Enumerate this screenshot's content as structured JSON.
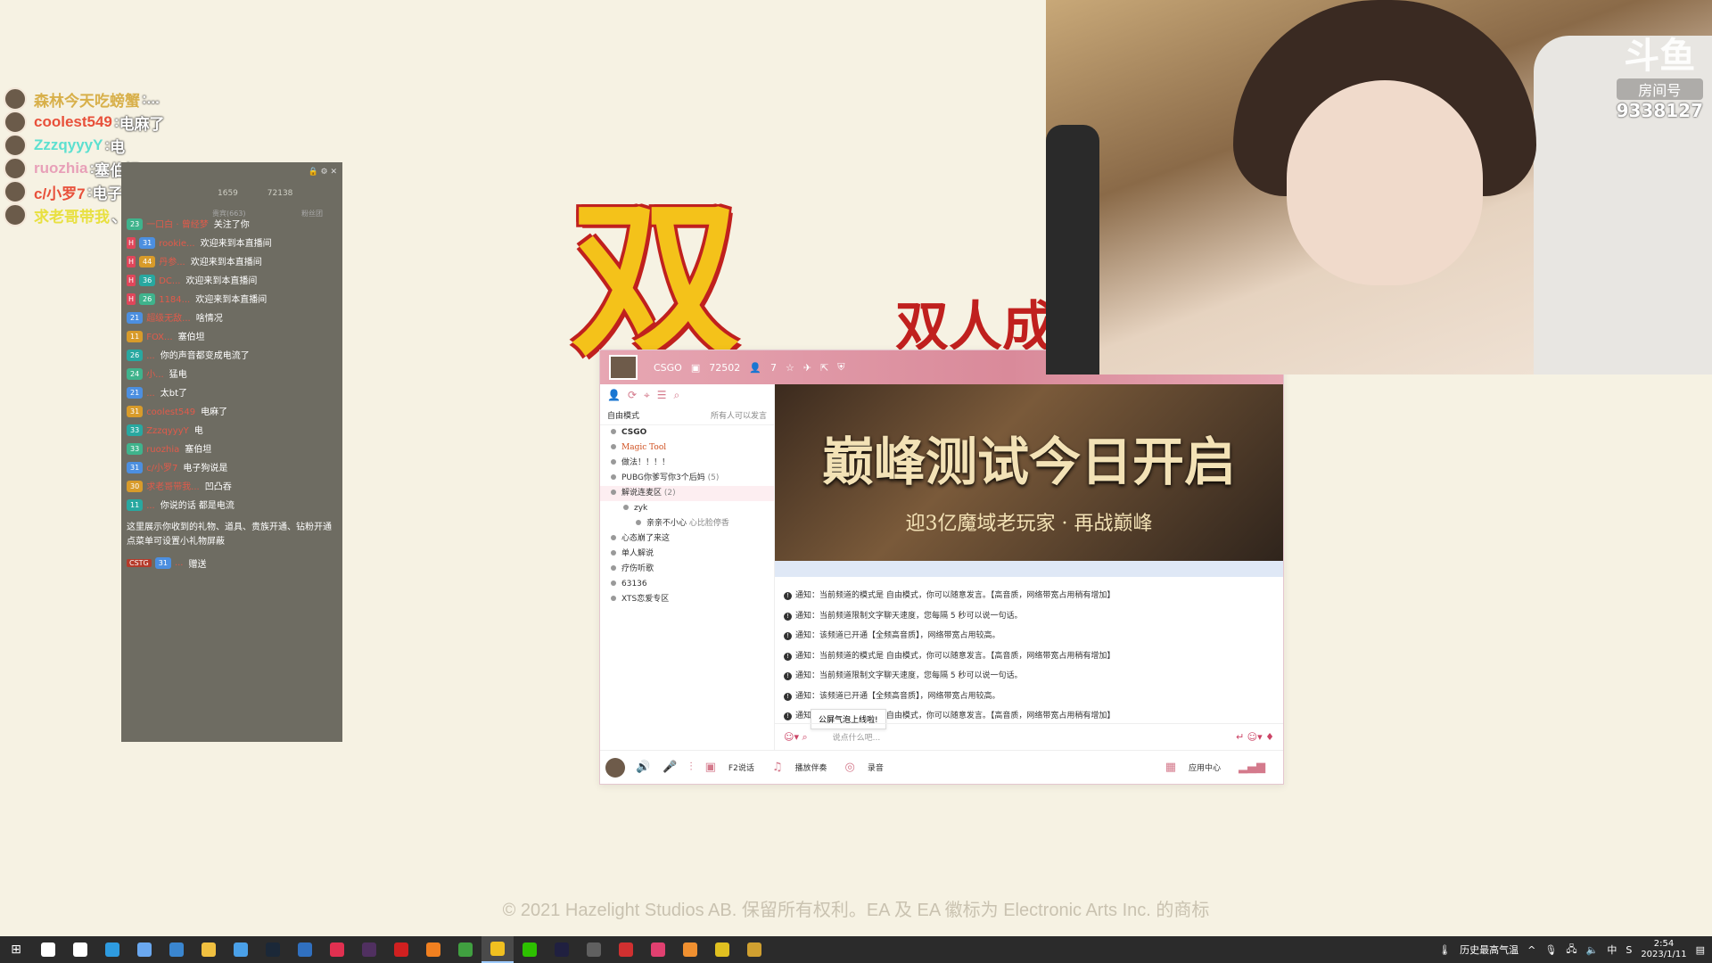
{
  "overlay_chat": [
    {
      "name": "森林今天吃螃蟹",
      "sep": ":",
      "msg": "...",
      "color": "#d8b04a"
    },
    {
      "name": "coolest549",
      "sep": ":",
      "msg": "电麻了",
      "color": "#e8503a"
    },
    {
      "name": "ZzzqyyyY",
      "sep": ":",
      "msg": "电",
      "color": "#5de0d0"
    },
    {
      "name": "ruozhia",
      "sep": ":",
      "msg": "塞伯坦",
      "color": "#e8a0b8"
    },
    {
      "name": "c/小罗7",
      "sep": ":",
      "msg": "电子狗说是",
      "color": "#e8503a"
    },
    {
      "name": "求老哥带我",
      "sep": "、",
      "msg": ":凹凸吞",
      "color": "#e8e040"
    }
  ],
  "chat_panel": {
    "stats": {
      "viewers": "1659",
      "likes": "72138"
    },
    "sub_left": "贵宾(663)",
    "sub_right": "粉丝团",
    "messages": [
      {
        "tag": "",
        "badge": "23",
        "user": "一口白 · 曾经梦",
        "text": "关注了你",
        "kind": "follow"
      },
      {
        "tag": "H",
        "badge": "31",
        "user": "rookie...",
        "text": "欢迎来到本直播间",
        "kind": "welcome"
      },
      {
        "tag": "H",
        "badge": "44",
        "user": "丹参...",
        "text": "欢迎来到本直播间",
        "kind": "welcome"
      },
      {
        "tag": "H",
        "badge": "36",
        "user": "DC...",
        "text": "欢迎来到本直播间",
        "kind": "welcome"
      },
      {
        "tag": "H",
        "badge": "26",
        "user": "1184...",
        "text": "欢迎来到本直播间",
        "kind": "welcome"
      },
      {
        "tag": "",
        "badge": "21",
        "user": "超级无敌...",
        "text": "啥情况",
        "kind": "chat"
      },
      {
        "tag": "",
        "badge": "11",
        "user": "FOX...",
        "text": "塞伯坦",
        "kind": "chat"
      },
      {
        "tag": "",
        "badge": "26",
        "user": "...",
        "text": "你的声音都变成电流了",
        "kind": "chat"
      },
      {
        "tag": "",
        "badge": "24",
        "user": "小...",
        "text": "猛电",
        "kind": "chat"
      },
      {
        "tag": "",
        "badge": "21",
        "user": "...",
        "text": "太bt了",
        "kind": "chat"
      },
      {
        "tag": "",
        "badge": "31",
        "user": "coolest549",
        "text": "电麻了",
        "kind": "chat"
      },
      {
        "tag": "",
        "badge": "33",
        "user": "ZzzqyyyY",
        "text": "电",
        "kind": "chat"
      },
      {
        "tag": "",
        "badge": "33",
        "user": "ruozhia",
        "text": "塞伯坦",
        "kind": "chat"
      },
      {
        "tag": "",
        "badge": "31",
        "user": "c/小罗7",
        "text": "电子狗说是",
        "kind": "chat"
      },
      {
        "tag": "",
        "badge": "30",
        "user": "求老哥带我...",
        "text": "凹凸吞",
        "kind": "chat"
      },
      {
        "tag": "",
        "badge": "11",
        "user": "...",
        "text": "你说的话 都是电流",
        "kind": "chat"
      }
    ],
    "tip_line1": "这里展示你收到的礼物、道具、贵族开通、钻粉开通",
    "tip_line2": "点菜单可设置小礼物屏蔽",
    "gift": {
      "tag": "CSTG",
      "badge": "31",
      "user": "...",
      "text": "赠送"
    }
  },
  "logo": {
    "big_char": "双",
    "chinese": "双人成"
  },
  "yy": {
    "title_game": "CSGO",
    "title_id": "72502",
    "title_users": "7",
    "mode_label": "自由模式",
    "mode_right": "所有人可以发言",
    "channels": [
      {
        "label": "CSGO",
        "style": "bold",
        "indent": 0
      },
      {
        "label": "Magic Tool",
        "style": "magic",
        "indent": 0
      },
      {
        "label": "做法！！！！",
        "style": "normal",
        "indent": 0
      },
      {
        "label": "PUBG你爹写你3个后妈",
        "style": "normal",
        "indent": 0,
        "count": "(5)"
      },
      {
        "label": "解说连麦区",
        "style": "active",
        "indent": 0,
        "count": "(2)"
      },
      {
        "label": "zyk",
        "style": "normal",
        "indent": 1
      },
      {
        "label": "亲亲不小心",
        "style": "normal",
        "indent": 2,
        "extra": "心比脸停香"
      },
      {
        "label": "心态崩了来这",
        "style": "normal",
        "indent": 0
      },
      {
        "label": "单人解说",
        "style": "normal",
        "indent": 0
      },
      {
        "label": "疗伤听歌",
        "style": "normal",
        "indent": 0
      },
      {
        "label": "63136",
        "style": "normal",
        "indent": 0
      },
      {
        "label": "XTS恋爱专区",
        "style": "normal",
        "indent": 0
      }
    ],
    "banner_title": "巅峰测试今日开启",
    "banner_sub": "迎3亿魔域老玩家 · 再战巅峰",
    "notices": [
      "通知：当前频道的模式是 自由模式，你可以随意发言。【高音质，网络带宽占用稍有增加】",
      "通知：当前频道限制文字聊天速度，您每隔 5 秒可以说一句话。",
      "通知：该频道已开通【全频高音质】，网络带宽占用较高。",
      "通知：当前频道的模式是 自由模式，你可以随意发言。【高音质，网络带宽占用稍有增加】",
      "通知：当前频道限制文字聊天速度，您每隔 5 秒可以说一句话。",
      "通知：该频道已开通【全频高音质】，网络带宽占用较高。",
      "通知：当前频道的模式是 自由模式，你可以随意发言。【高音质，网络带宽占用稍有增加】"
    ],
    "bubble": "公屏气泡上线啦!",
    "input_placeholder": "说点什么吧...",
    "bottom_f2": "F2说话",
    "bottom_music": "播放伴奏",
    "bottom_record": "录音",
    "bottom_app": "应用中心"
  },
  "webcam_watermark": {
    "title": "斗鱼",
    "sub": "房间号",
    "room": "9338127"
  },
  "copyright": "© 2021 Hazelight Studios AB. 保留所有权利。EA 及 EA 徽标为 Electronic Arts Inc. 的商标",
  "taskbar": {
    "weather": "历史最高气温",
    "ime": "中",
    "time": "2:54",
    "date": "2023/1/11",
    "apps": [
      {
        "name": "search-icon",
        "color": "#ffffff"
      },
      {
        "name": "taskview-icon",
        "color": "#ffffff"
      },
      {
        "name": "edge-icon",
        "color": "#2e9be0"
      },
      {
        "name": "store-icon",
        "color": "#6aa8f0"
      },
      {
        "name": "mail-icon",
        "color": "#3a86d0"
      },
      {
        "name": "explorer-icon",
        "color": "#f0c040"
      },
      {
        "name": "browser-icon",
        "color": "#4aa0e8"
      },
      {
        "name": "steam-icon",
        "color": "#1b2838"
      },
      {
        "name": "app-blue-icon",
        "color": "#3070c0"
      },
      {
        "name": "app-red-icon",
        "color": "#e03050"
      },
      {
        "name": "app-dark-icon",
        "color": "#503060"
      },
      {
        "name": "netease-icon",
        "color": "#d02020"
      },
      {
        "name": "app-orange-icon",
        "color": "#f08020"
      },
      {
        "name": "chrome-icon",
        "color": "#40a040"
      },
      {
        "name": "yy-icon",
        "color": "#f0c020"
      },
      {
        "name": "wechat-icon",
        "color": "#2dc100"
      },
      {
        "name": "se-icon",
        "color": "#202040"
      },
      {
        "name": "app-gray-icon",
        "color": "#606060"
      },
      {
        "name": "app-red2-icon",
        "color": "#d03030"
      },
      {
        "name": "app-pink-icon",
        "color": "#e04070"
      },
      {
        "name": "app-orange2-icon",
        "color": "#f09030"
      },
      {
        "name": "app-yellow-icon",
        "color": "#e0c020"
      },
      {
        "name": "game-icon",
        "color": "#d0a030"
      }
    ]
  }
}
